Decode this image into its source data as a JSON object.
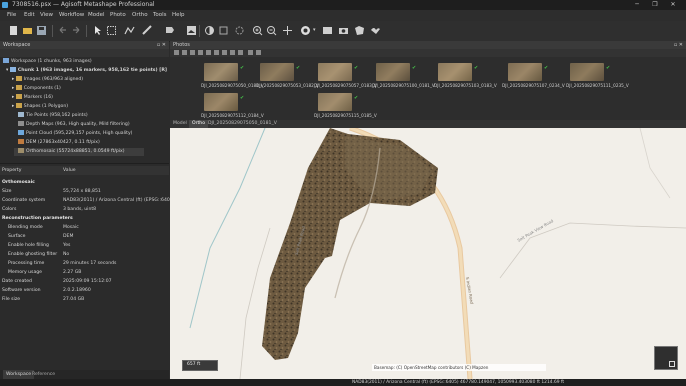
{
  "window": {
    "title": "7308516.psx — Agisoft Metashape Professional",
    "controls": [
      "─",
      "❐",
      "✕"
    ]
  },
  "menu": [
    "File",
    "Edit",
    "View",
    "Workflow",
    "Model",
    "Photo",
    "Ortho",
    "Tools",
    "Help"
  ],
  "workspace": {
    "header": "Workspace",
    "items": [
      "Workspace (1 chunks, 963 images)",
      "Chunk 1 (963 images, 16 markers, 958,162 tie points) [R]",
      "Images (963/963 aligned)",
      "Components (1)",
      "Markers (16)",
      "Shapes (1 Polygon)",
      "Tie Points (958,162 points)",
      "Depth Maps (963, High quality, Mild filtering)",
      "Point Cloud (595,229,157 points, High quality)",
      "DEM (27863x40427, 0.11 ft/pix)",
      "Orthomosaic (55724x88851, 0.0549 ft/pix)"
    ]
  },
  "properties": {
    "col_property": "Property",
    "col_value": "Value",
    "rows": [
      {
        "k": "Orthomosaic",
        "v": "",
        "section": true
      },
      {
        "k": "Size",
        "v": "55,724 x 88,851"
      },
      {
        "k": "Coordinate system",
        "v": "NAD83(2011) / Arizona Central (ft) (EPSG::6405)"
      },
      {
        "k": "Colors",
        "v": "3 bands, uint8"
      },
      {
        "k": "Reconstruction parameters",
        "v": "",
        "section": true
      },
      {
        "k": "Blending mode",
        "v": "Mosaic"
      },
      {
        "k": "Surface",
        "v": "DEM"
      },
      {
        "k": "Enable hole filling",
        "v": "Yes"
      },
      {
        "k": "Enable ghosting filter",
        "v": "No"
      },
      {
        "k": "Processing time",
        "v": "29 minutes 17 seconds"
      },
      {
        "k": "Memory usage",
        "v": "2.27 GB"
      },
      {
        "k": "Date created",
        "v": "2025:09:09 15:12:07"
      },
      {
        "k": "Software version",
        "v": "2.0.2.18960"
      },
      {
        "k": "File size",
        "v": "27.04 GB"
      }
    ]
  },
  "bottom_tabs": [
    "Workspace",
    "Reference"
  ],
  "photos": {
    "header": "Photos",
    "items": [
      "DJI_20250829075050_0181_V",
      "DJI_20250829075053_0182_V",
      "DJI_20250829075057_0183_V",
      "DJI_20250829075100_0181_V",
      "DJI_20250829075103_0183_V",
      "DJI_20250829075107_0234_V",
      "DJI_20250829075111_0235_V",
      "DJI_20250829075112_0184_V",
      "DJI_20250829075115_0185_V"
    ]
  },
  "view_tabs": [
    "Model",
    "Ortho",
    "DJI_20250829075050_0181_V"
  ],
  "map": {
    "scale": "657 ft",
    "attribution": "Basemap: (C) OpenStreetMap contributors (C) Mapzen",
    "road_label_1": "Salt Peak Road",
    "road_label_2": "Salt Peak View Road",
    "road_label_3": "S Indian Road"
  },
  "status": "NAD83(2011) / Arizona Central (ft) (EPSG::6405)  467780.149047, 1050993.403080 ft  1214.69 ft"
}
